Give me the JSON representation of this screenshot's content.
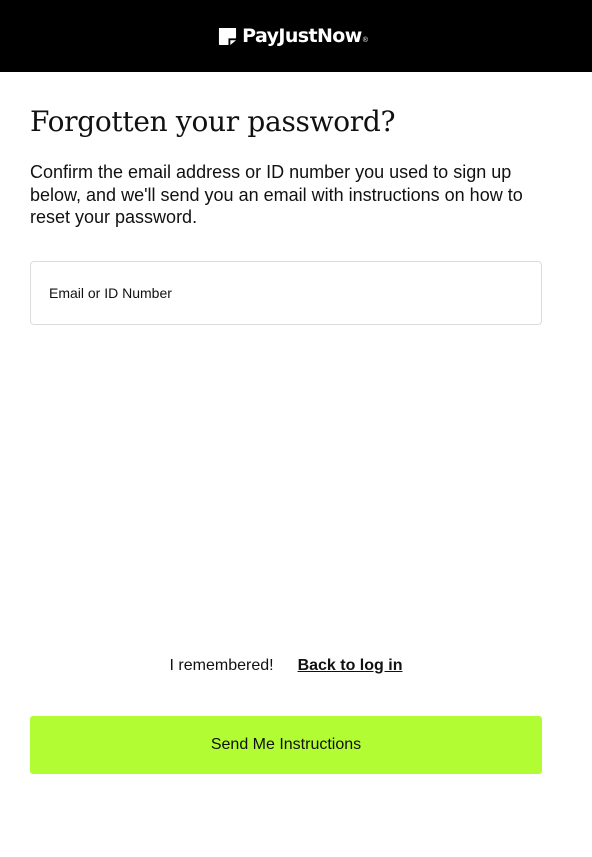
{
  "header": {
    "brand": "PayJustNow",
    "brand_mark": "®",
    "logo_icon": "brand-flag-icon",
    "background": "#000000"
  },
  "main": {
    "title": "Forgotten your password?",
    "description": "Confirm the email address or ID number you used to sign up below, and we'll send you an email with instructions on how to reset your password.",
    "email_field": {
      "placeholder": "Email or ID Number",
      "value": ""
    }
  },
  "footer": {
    "remember_text": "I remembered!",
    "back_link": "Back to log in",
    "submit_label": "Send Me Instructions"
  },
  "colors": {
    "accent": "#b2fc33",
    "text": "#111111",
    "field_border": "#dcdcdc"
  }
}
